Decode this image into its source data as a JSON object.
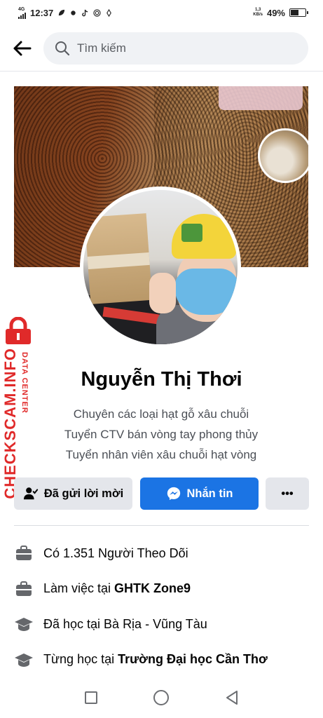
{
  "status_bar": {
    "network": "4G",
    "time": "12:37",
    "speed_value": "1,3",
    "speed_unit": "KB/s",
    "battery": "49%",
    "battery_level": 0.49
  },
  "header": {
    "back_icon": "arrow-left-icon",
    "search_placeholder": "Tìm kiếm"
  },
  "watermark": {
    "brand": "CHECKSCAM.INFO",
    "sub": "DATA CENTER"
  },
  "profile": {
    "name": "Nguyễn Thị Thơi",
    "bio": [
      "Chuyên các loại hạt gỗ xâu chuỗi",
      "Tuyển CTV bán vòng tay phong thủy",
      "Tuyển nhân viên xâu chuỗi hạt vòng"
    ]
  },
  "actions": {
    "friend_request": "Đã gửi lời mời",
    "message": "Nhắn tin",
    "more": "•••",
    "colors": {
      "primary": "#1b74e4",
      "secondary": "#e4e6eb"
    }
  },
  "details": [
    {
      "icon": "briefcase-icon",
      "prefix": "Có 1.351 Người Theo Dõi",
      "bold": ""
    },
    {
      "icon": "briefcase-icon",
      "prefix": "Làm việc tại ",
      "bold": "GHTK Zone9"
    },
    {
      "icon": "graduation-cap-icon",
      "prefix": "Đã học tại Bà Rịa - Vũng Tàu",
      "bold": ""
    },
    {
      "icon": "graduation-cap-icon",
      "prefix": "Từng học tại ",
      "bold": "Trường Đại học Cần Thơ"
    }
  ],
  "navbar": {
    "recents_icon": "square-icon",
    "home_icon": "circle-icon",
    "back_icon": "triangle-back-icon"
  }
}
